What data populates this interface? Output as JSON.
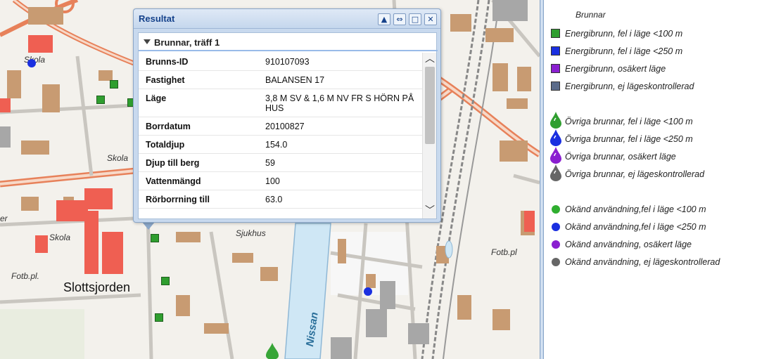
{
  "map": {
    "labels": {
      "skola_1": "Skola",
      "skola_2": "Skola",
      "skola_3": "Skola",
      "sjukhus": "Sjukhus",
      "fotb_1": "Fotb.pl.",
      "fotb_2": "Fotb.pl",
      "slottsjorden": "Slottsjorden",
      "nissan": "Nissan",
      "partial": "er"
    }
  },
  "popup": {
    "title": "Resultat",
    "buttons": {
      "collapse": "▲",
      "dock": "⇔",
      "maximize": "□",
      "close": "✕"
    },
    "section_label": "Brunnar, träff 1",
    "rows": [
      {
        "key": "Brunns-ID",
        "value": "910107093"
      },
      {
        "key": "Fastighet",
        "value": "BALANSEN 17"
      },
      {
        "key": "Läge",
        "value": "3,8 M SV & 1,6 M NV FR S HÖRN PÅ HUS"
      },
      {
        "key": "Borrdatum",
        "value": "20100827"
      },
      {
        "key": "Totaldjup",
        "value": "154.0"
      },
      {
        "key": "Djup till berg",
        "value": "59"
      },
      {
        "key": "Vattenmängd",
        "value": "100"
      },
      {
        "key": "Rörborrning till",
        "value": "63.0"
      }
    ],
    "scroll": {
      "up": "︿",
      "down": "﹀"
    }
  },
  "legend": {
    "title": "Brunnar",
    "items": [
      {
        "label": "Energibrunn, fel i läge <100 m",
        "symbol": "square",
        "color": "#2f9e2f"
      },
      {
        "label": "Energibrunn, fel i läge <250 m",
        "symbol": "square",
        "color": "#1a2fe0"
      },
      {
        "label": "Energibrunn, osäkert läge",
        "symbol": "square",
        "color": "#8a1fd0"
      },
      {
        "label": "Energibrunn, ej lägeskontrollerad",
        "symbol": "square",
        "color": "#5b6b8a"
      },
      {
        "label": "Övriga brunnar, fel i läge <100 m",
        "symbol": "drop",
        "color": "#2f9e2f"
      },
      {
        "label": "Övriga brunnar, fel i läge <250 m",
        "symbol": "drop",
        "color": "#1a2fe0"
      },
      {
        "label": "Övriga brunnar, osäkert läge",
        "symbol": "drop",
        "color": "#8a1fd0"
      },
      {
        "label": "Övriga brunnar, ej lägeskontrollerad",
        "symbol": "drop",
        "color": "#666666"
      },
      {
        "label": "Okänd användning,fel i läge <100 m",
        "symbol": "dot",
        "color": "#2fae2f"
      },
      {
        "label": "Okänd användning,fel i läge <250 m",
        "symbol": "dot",
        "color": "#1a2fe0"
      },
      {
        "label": "Okänd användning, osäkert läge",
        "symbol": "dot",
        "color": "#8a1fd0"
      },
      {
        "label": "Okänd användning, ej lägeskontrollerad",
        "symbol": "dot",
        "color": "#666666"
      }
    ]
  }
}
